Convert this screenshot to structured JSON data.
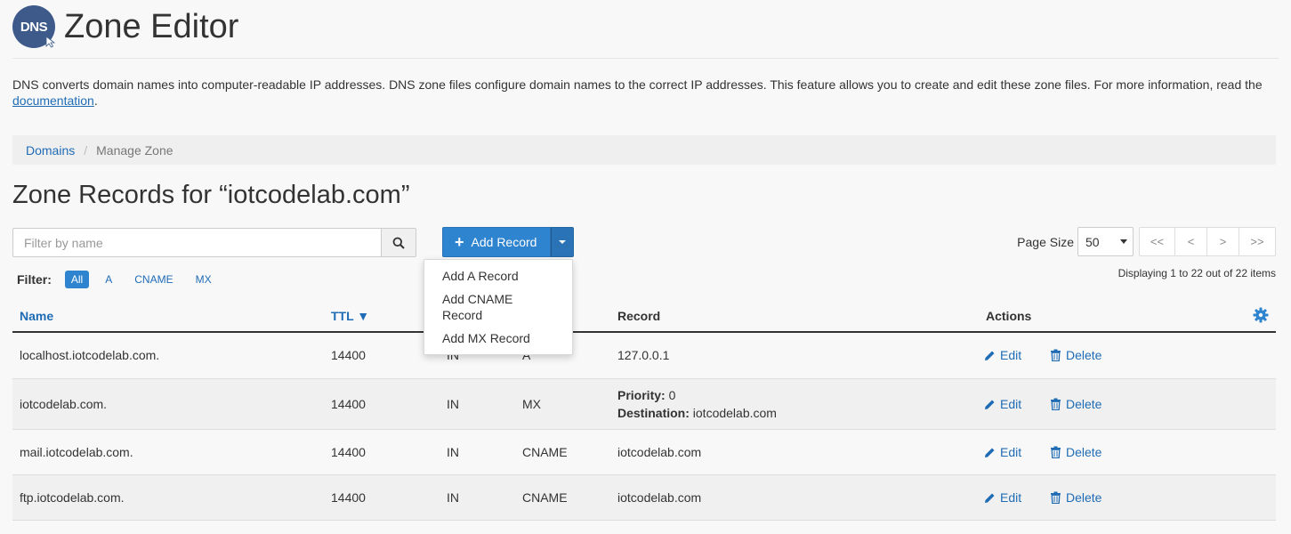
{
  "header": {
    "logo_text": "DNS",
    "title": "Zone Editor"
  },
  "intro": {
    "text": "DNS converts domain names into computer-readable IP addresses. DNS zone files configure domain names to the correct IP addresses. This feature allows you to create and edit these zone files. For more information, read the ",
    "link_text": "documentation",
    "suffix": "."
  },
  "breadcrumb": {
    "items": [
      "Domains",
      "Manage Zone"
    ],
    "separator": "/"
  },
  "section_title": "Zone Records for “iotcodelab.com”",
  "search": {
    "placeholder": "Filter by name"
  },
  "add_record": {
    "label": "Add Record",
    "menu": [
      "Add A Record",
      "Add CNAME Record",
      "Add MX Record"
    ]
  },
  "pagination": {
    "page_size_label": "Page Size",
    "page_size": "50",
    "buttons": [
      "<<",
      "<",
      ">",
      ">>"
    ],
    "displaying": "Displaying 1 to 22 out of 22 items"
  },
  "filter": {
    "label": "Filter:",
    "options": [
      "All",
      "A",
      "CNAME",
      "MX"
    ],
    "active": "All"
  },
  "table": {
    "columns": {
      "name": "Name",
      "ttl": "TTL ▼",
      "record": "Record",
      "actions": "Actions"
    },
    "edit_label": "Edit",
    "delete_label": "Delete",
    "rows": [
      {
        "name": "localhost.iotcodelab.com.",
        "ttl": "14400",
        "class": "IN",
        "type": "A",
        "record": "127.0.0.1"
      },
      {
        "name": "iotcodelab.com.",
        "ttl": "14400",
        "class": "IN",
        "type": "MX",
        "priority_label": "Priority:",
        "priority": " 0",
        "destination_label": "Destination:",
        "destination": " iotcodelab.com"
      },
      {
        "name": "mail.iotcodelab.com.",
        "ttl": "14400",
        "class": "IN",
        "type": "CNAME",
        "record": "iotcodelab.com"
      },
      {
        "name": "ftp.iotcodelab.com.",
        "ttl": "14400",
        "class": "IN",
        "type": "CNAME",
        "record": "iotcodelab.com"
      }
    ]
  },
  "colors": {
    "primary": "#2f84cf",
    "link": "#1f6cb5",
    "logo": "#3d5a8a"
  }
}
